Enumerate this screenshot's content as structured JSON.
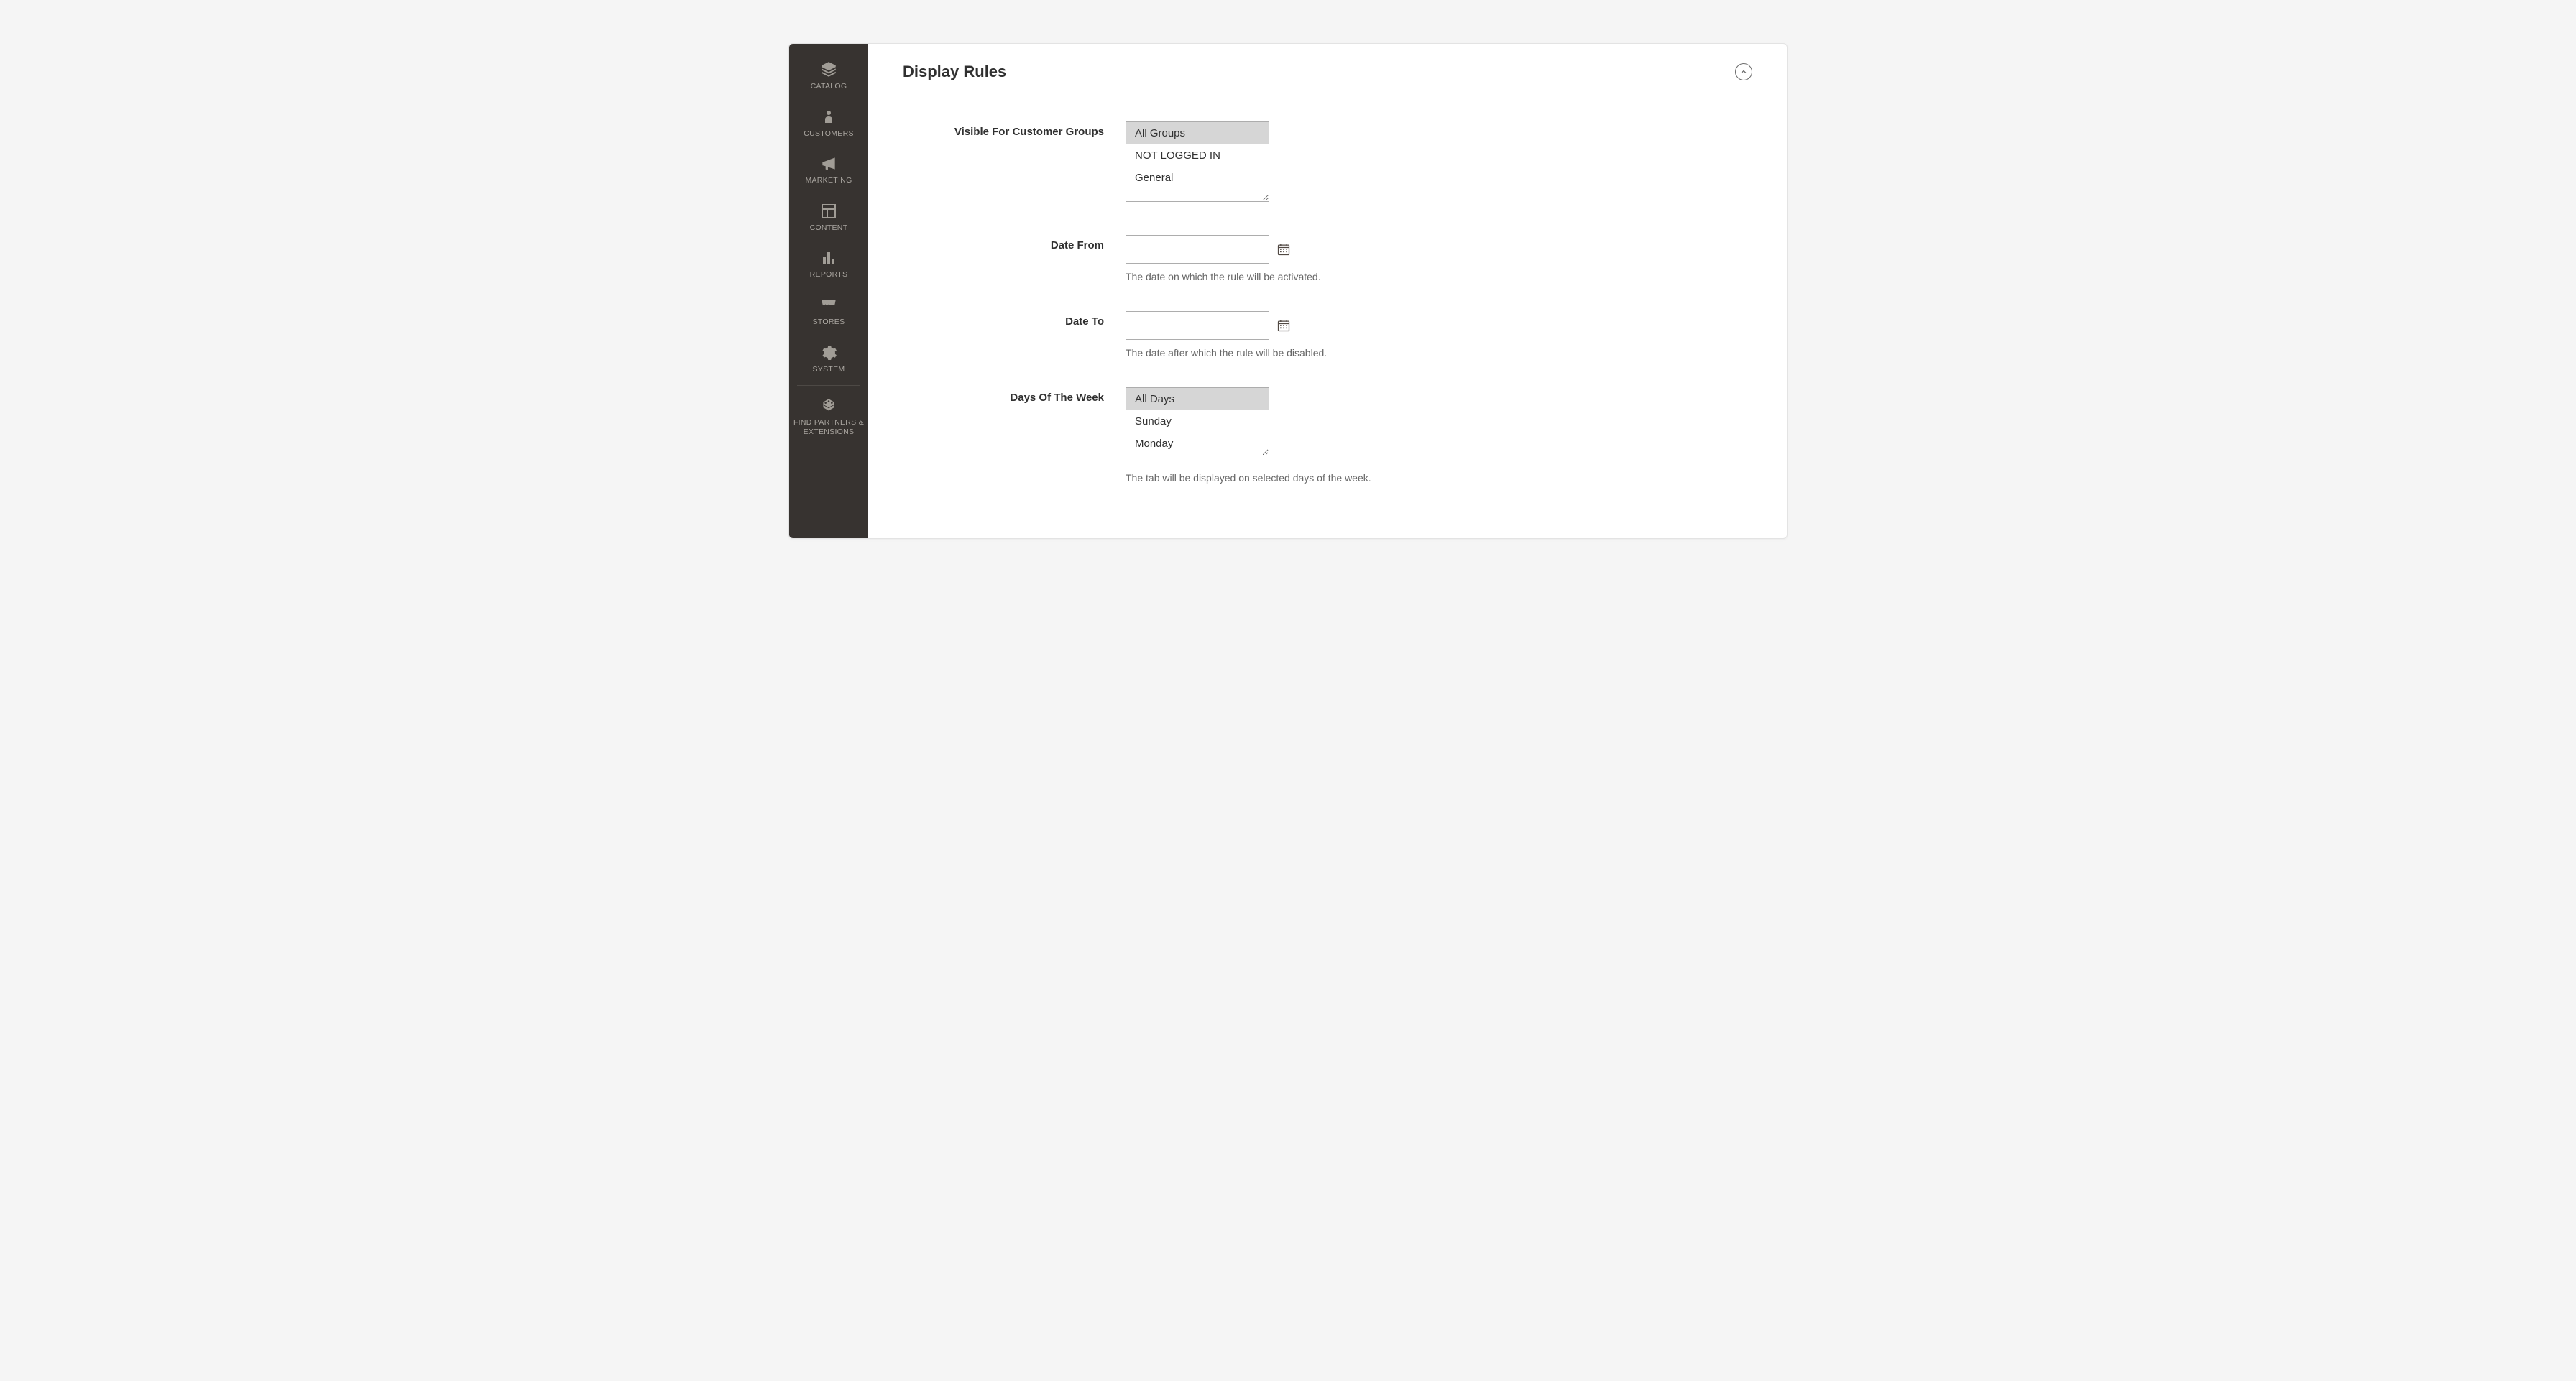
{
  "sidebar": {
    "items": [
      {
        "label": "CATALOG",
        "icon": "catalog"
      },
      {
        "label": "CUSTOMERS",
        "icon": "customers"
      },
      {
        "label": "MARKETING",
        "icon": "marketing"
      },
      {
        "label": "CONTENT",
        "icon": "content"
      },
      {
        "label": "REPORTS",
        "icon": "reports"
      },
      {
        "label": "STORES",
        "icon": "stores"
      },
      {
        "label": "SYSTEM",
        "icon": "system"
      },
      {
        "label": "FIND PARTNERS & EXTENSIONS",
        "icon": "partners"
      }
    ]
  },
  "section": {
    "title": "Display Rules"
  },
  "fields": {
    "customer_groups": {
      "label": "Visible For Customer Groups",
      "options": [
        "All Groups",
        "NOT LOGGED IN",
        "General"
      ],
      "selected": "All Groups"
    },
    "date_from": {
      "label": "Date From",
      "value": "",
      "helper": "The date on which the rule will be activated."
    },
    "date_to": {
      "label": "Date To",
      "value": "",
      "helper": "The date after which the rule will be disabled."
    },
    "days_of_week": {
      "label": "Days Of The Week",
      "options": [
        "All Days",
        "Sunday",
        "Monday"
      ],
      "selected": "All Days",
      "helper": "The tab will be displayed on selected days of the week."
    }
  }
}
